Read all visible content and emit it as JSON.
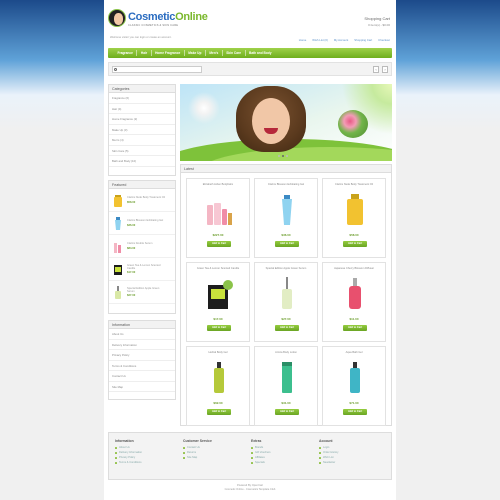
{
  "header": {
    "brand_part1": "Cosmetic",
    "brand_part2": "Online",
    "tagline": "CLASSIC COSMETICS & SKIN CARE",
    "cart_title": "Shopping Cart",
    "cart_summary": "0 item(s) - $0.00",
    "welcome": "Welcome visitor you can login or create an account.",
    "top_links": [
      "Home",
      "Wish List (0)",
      "My Account",
      "Shopping Cart",
      "Checkout"
    ]
  },
  "nav": {
    "items": [
      "Fragrance",
      "Hair",
      "Home Fragrance",
      "Make Up",
      "Men's",
      "Skin Care",
      "Bath and Body"
    ]
  },
  "search": {
    "placeholder": "",
    "prev": "‹",
    "next": "›"
  },
  "categories": {
    "title": "Categories",
    "items": [
      "Fragrance (6)",
      "Hair (4)",
      "Home Fragrance (2)",
      "Make Up (3)",
      "Men's (4)",
      "Skin Care (5)",
      "Bath and Body (10)"
    ]
  },
  "featured": {
    "title": "Featured",
    "items": [
      {
        "name": "Clarins Nude Body Treatment Oil",
        "price": "$58.00"
      },
      {
        "name": "Clarins Blossom Exfoliating Gel",
        "price": "$36.00"
      },
      {
        "name": "Clarins Double Serum",
        "price": "$84.00"
      },
      {
        "name": "Green Tea & Lemon Scented Candle",
        "price": "$17.00"
      },
      {
        "name": "Special Edition Apple Green Serum",
        "price": "$27.00"
      }
    ]
  },
  "information": {
    "title": "Information",
    "items": [
      "About Us",
      "Delivery Information",
      "Privacy Policy",
      "Terms & Conditions",
      "Contact Us",
      "Site Map"
    ]
  },
  "latest": {
    "title": "Latest",
    "add_label": "Add to Cart",
    "products": [
      {
        "name": "Elizabeth Arden Bodybalm",
        "price": "$227.00",
        "art": "bottles"
      },
      {
        "name": "Clarins Blossom Exfoliating Gel",
        "price": "$36.00",
        "art": "tube"
      },
      {
        "name": "Clarins Nude Body Treatment Oil",
        "price": "$58.00",
        "art": "oil"
      },
      {
        "name": "Green Tea & Lemon Scented Candle",
        "price": "$17.00",
        "art": "candle"
      },
      {
        "name": "Special Edition Apple Green Serum",
        "price": "$27.00",
        "art": "dropper"
      },
      {
        "name": "Japanese Cherry Blossom Diffuser",
        "price": "$11.00",
        "art": "pink"
      },
      {
        "name": "Herbal Body Gel",
        "price": "$62.00",
        "art": "green"
      },
      {
        "name": "Arnica Body Lotion",
        "price": "$31.00",
        "art": "tealtube"
      },
      {
        "name": "Aqua Bath Gel",
        "price": "$71.00",
        "art": "blue"
      }
    ]
  },
  "footer": {
    "columns": [
      {
        "title": "Information",
        "links": [
          "About Us",
          "Delivery Information",
          "Privacy Policy",
          "Terms & Conditions"
        ]
      },
      {
        "title": "Customer Service",
        "links": [
          "Contact Us",
          "Returns",
          "Site Map"
        ]
      },
      {
        "title": "Extras",
        "links": [
          "Brands",
          "Gift Vouchers",
          "Affiliates",
          "Specials"
        ]
      },
      {
        "title": "Account",
        "links": [
          "Login",
          "Order History",
          "Wish List",
          "Newsletter"
        ]
      }
    ],
    "powered_1": "Powered By OpenCart",
    "powered_2": "Cosmetic Online - Cosmetics Template Club"
  },
  "colors": {
    "accent": "#7ab82c",
    "brand_blue": "#2a6cc0",
    "price": "#6a9c2a"
  }
}
